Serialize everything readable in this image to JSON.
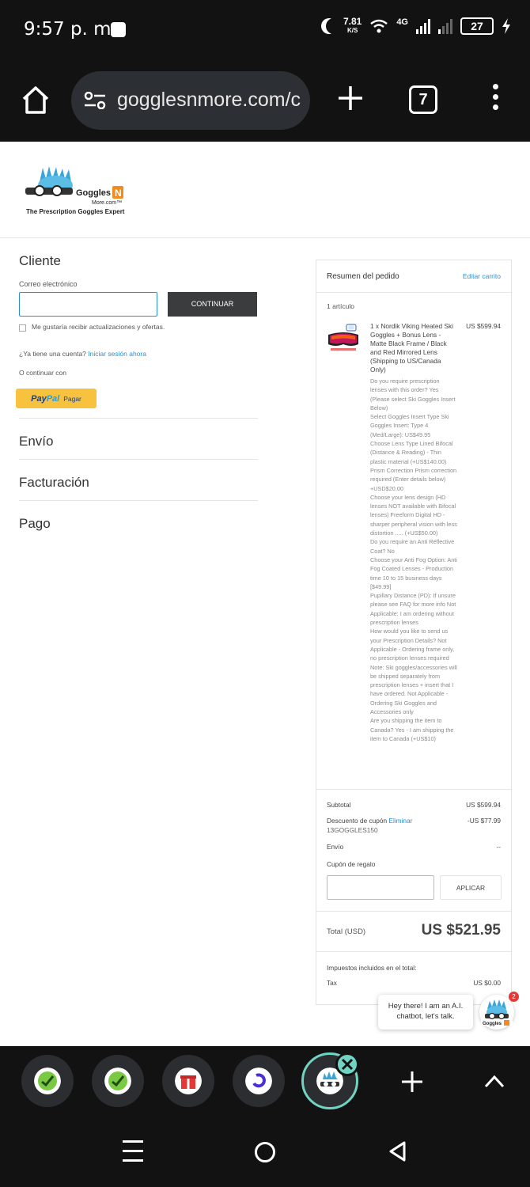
{
  "status_bar": {
    "time": "9:57 p. m.",
    "net_speed_value": "7.81",
    "net_speed_unit": "K/S",
    "network_type": "4G",
    "battery": "27"
  },
  "browser": {
    "url": "gogglesnmore.com/c",
    "tab_count": "7"
  },
  "site": {
    "logo_text": "Goggles N More.com™",
    "tagline": "The Prescription Goggles Expert"
  },
  "checkout": {
    "customer_title": "Cliente",
    "email_label": "Correo electrónico",
    "email_value": "",
    "continue_button": "CONTINUAR",
    "newsletter_label": "Me gustaría recibir actualizaciones y ofertas.",
    "account_prompt": "¿Ya tiene una cuenta?",
    "login_link": "Iniciar sesión ahora",
    "or_continue": "O continuar con",
    "paypal_brand_a": "Pay",
    "paypal_brand_b": "Pal",
    "paypal_action": "Pagar",
    "shipping_title": "Envío",
    "billing_title": "Facturación",
    "payment_title": "Pago"
  },
  "summary": {
    "title": "Resumen del pedido",
    "edit_cart": "Editar carrito",
    "item_count": "1 artículo",
    "item": {
      "name": "1 x Nordik Viking Heated Ski Goggles + Bonus Lens - Matte Black Frame / Black and Red Mirrored Lens (Shipping to US/Canada Only)",
      "price": "US $599.94",
      "options": [
        "Do you require prescription lenses with this order? Yes (Please select Ski Goggles Insert Below)",
        "Select Goggles Insert Type Ski Goggles Insert: Type 4 (Med/Large): US$49.95",
        "Choose Lens Type Lined Bifocal (Distance & Reading) - Thin plastic material (+US$140.00)",
        "Prism Correction Prism correction required (Enter details below) +USD$20.00",
        "Choose your lens design (HD lenses NOT available with Bifocal lenses) Freeform Digital HD - sharper peripheral vision with less distortion ..... (+US$50.00)",
        "Do you require an Anti Reflective Coat? No",
        "Choose your Anti Fog Option: Anti Fog Coated Lenses - Production time 10 to 15 business days [$49.99]",
        "Pupillary Distance (PD): If unsure please see FAQ for more info Not Applicable: I am ordering without prescription lenses",
        "How would you like to send us your Prescription Details? Not Applicable - Ordering frame only, no prescription lenses required",
        "Note: Ski goggles/accessories will be shipped separately from prescription lenses + insert that I have ordered. Not Applicable - Ordering Ski Goggles and Accessories only",
        "Are you shipping the item to Canada? Yes - I am shipping the item to Canada (+US$10)"
      ]
    },
    "subtotal_label": "Subtotal",
    "subtotal_value": "US $599.94",
    "coupon_label": "Descuento de cupón",
    "coupon_remove": "Eliminar",
    "coupon_code": "13GOGGLES150",
    "coupon_value": "-US $77.99",
    "shipping_label": "Envío",
    "shipping_value": "--",
    "gift_label": "Cupón de regalo",
    "gift_value": "",
    "apply_button": "APLICAR",
    "total_label": "Total (USD)",
    "total_value": "US $521.95",
    "taxes_included_label": "Impuestos incluidos en el total:",
    "tax_label": "Tax",
    "tax_value": "US $0.00"
  },
  "chat": {
    "message": "Hey there! I am an A.I. chatbot, let's talk.",
    "badge": "2"
  },
  "colors": {
    "link": "#2a8fd6",
    "dark_button": "#3b3c3e",
    "paypal_yellow": "#f7c33f",
    "active_tab_ring": "#6fd4c3",
    "system_bar": "#121212"
  },
  "tab_strip": {
    "tabs": [
      {
        "icon": "leaf-check-icon"
      },
      {
        "icon": "leaf-check-icon"
      },
      {
        "icon": "gift-icon"
      },
      {
        "icon": "swirl-icon"
      },
      {
        "icon": "goggles-logo-icon",
        "active": true
      }
    ]
  }
}
